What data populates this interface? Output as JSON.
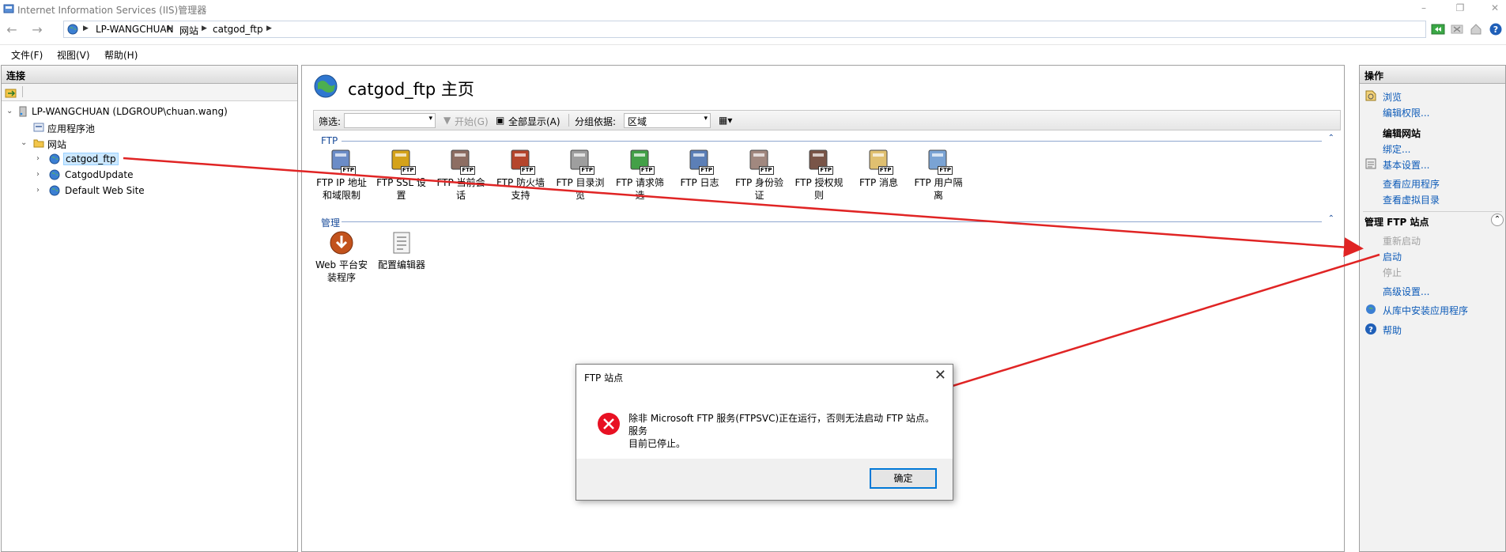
{
  "window": {
    "title": "Internet Information Services (IIS)管理器",
    "controls": {
      "minimize": "–",
      "restore": "❐",
      "close": "✕"
    }
  },
  "nav": {
    "back": "←",
    "forward": "→",
    "breadcrumbs": [
      "LP-WANGCHUAN",
      "网站",
      "catgod_ftp"
    ]
  },
  "menu": {
    "items": [
      "文件(F)",
      "视图(V)",
      "帮助(H)"
    ]
  },
  "connections": {
    "header": "连接",
    "tree": {
      "server": "LP-WANGCHUAN (LDGROUP\\chuan.wang)",
      "app_pools": "应用程序池",
      "sites": "网站",
      "site_list": [
        "catgod_ftp",
        "CatgodUpdate",
        "Default Web Site"
      ]
    }
  },
  "center": {
    "title": "catgod_ftp 主页",
    "filter": {
      "label": "筛选:",
      "start": "开始(G)",
      "show_all": "全部显示(A)",
      "group_label": "分组依据:",
      "group_value": "区域"
    },
    "sections": {
      "ftp": {
        "label": "FTP",
        "features": [
          {
            "line1": "FTP IP 地址",
            "line2": "和域限制"
          },
          {
            "line1": "FTP SSL 设",
            "line2": "置"
          },
          {
            "line1": "FTP 当前会",
            "line2": "话"
          },
          {
            "line1": "FTP 防火墙",
            "line2": "支持"
          },
          {
            "line1": "FTP 目录浏",
            "line2": "览"
          },
          {
            "line1": "FTP 请求筛",
            "line2": "选"
          },
          {
            "line1": "FTP 日志",
            "line2": ""
          },
          {
            "line1": "FTP 身份验",
            "line2": "证"
          },
          {
            "line1": "FTP 授权规",
            "line2": "则"
          },
          {
            "line1": "FTP 消息",
            "line2": ""
          },
          {
            "line1": "FTP 用户隔",
            "line2": "离"
          }
        ],
        "badge": "FTP"
      },
      "management": {
        "label": "管理",
        "features": [
          {
            "line1": "Web 平台安",
            "line2": "装程序"
          },
          {
            "line1": "配置编辑器",
            "line2": ""
          }
        ]
      }
    }
  },
  "actions": {
    "header": "操作",
    "browse": "浏览",
    "edit_permissions": "编辑权限...",
    "edit_site_group": "编辑网站",
    "bindings": "绑定...",
    "basic_settings": "基本设置...",
    "view_applications": "查看应用程序",
    "view_virtual_dirs": "查看虚拟目录",
    "manage_ftp_group": "管理 FTP 站点",
    "restart": "重新启动",
    "start": "启动",
    "stop": "停止",
    "advanced_settings": "高级设置...",
    "install_from_gallery": "从库中安装应用程序",
    "help": "帮助"
  },
  "dialog": {
    "title": "FTP 站点",
    "close": "✕",
    "message_line1": "除非 Microsoft FTP 服务(FTPSVC)正在运行，否则无法启动 FTP 站点。服务",
    "message_line2": "目前已停止。",
    "ok": "确定"
  },
  "colors": {
    "link": "#0d5bb8",
    "annotation_arrow": "#e02424",
    "error_icon": "#e81123",
    "section_header": "#1a4c9a"
  }
}
